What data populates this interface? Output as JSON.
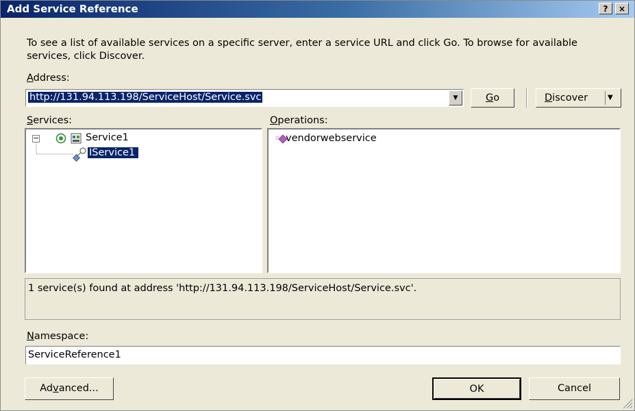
{
  "window": {
    "title": "Add Service Reference",
    "help_glyph": "?",
    "close_glyph": "×"
  },
  "intro_text": "To see a list of available services on a specific server, enter a service URL and click Go. To browse for available services, click Discover.",
  "address": {
    "label_prefix": "",
    "label_hotkey": "A",
    "label_rest": "ddress:",
    "value": "http://131.94.113.198/ServiceHost/Service.svc"
  },
  "buttons": {
    "go_hotkey": "G",
    "go_rest": "o",
    "discover_hotkey": "D",
    "discover_rest": "iscover",
    "advanced_prefix": "Ad",
    "advanced_hotkey": "v",
    "advanced_rest": "anced...",
    "ok": "OK",
    "cancel": "Cancel"
  },
  "services": {
    "label_hotkey": "S",
    "label_rest": "ervices:",
    "items": [
      {
        "label": "Service1",
        "icon": "service-icon",
        "expanded": true
      },
      {
        "label": "IService1",
        "icon": "contract-icon",
        "selected": true
      }
    ]
  },
  "operations": {
    "label_hotkey": "O",
    "label_rest": "perations:",
    "items": [
      {
        "label": "vendorwebservice",
        "icon": "method-icon"
      }
    ]
  },
  "status_message": "1 service(s) found at address 'http://131.94.113.198/ServiceHost/Service.svc'.",
  "namespace": {
    "label_hotkey": "N",
    "label_rest": "amespace:",
    "value": "ServiceReference1"
  },
  "colors": {
    "selection": "#0a246a",
    "dialog_bg": "#ece9d8",
    "method_icon": "#b05cc0"
  }
}
